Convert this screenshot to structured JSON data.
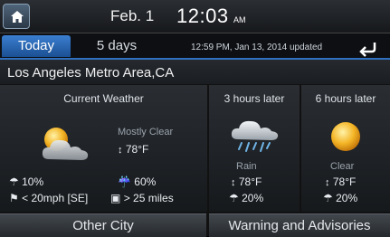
{
  "topbar": {
    "date": "Feb.  1",
    "time": "12:03",
    "ampm": "AM"
  },
  "tabs": [
    {
      "label": "Today"
    },
    {
      "label": "5 days"
    }
  ],
  "updated": "12:59 PM, Jan 13, 2014 updated",
  "location": "Los Angeles Metro Area,CA",
  "current": {
    "title": "Current Weather",
    "condition": "Mostly Clear",
    "temp": "78°F",
    "precip": "10%",
    "humidity": "60%",
    "wind": "< 20mph [SE]",
    "visibility": "> 25 miles"
  },
  "later3": {
    "title": "3 hours later",
    "condition": "Rain",
    "temp": "78°F",
    "precip": "20%"
  },
  "later6": {
    "title": "6 hours later",
    "condition": "Clear",
    "temp": "78°F",
    "precip": "20%"
  },
  "buttons": {
    "other_city": "Other City",
    "warnings": "Warning and Advisories"
  },
  "icons": [
    "home-icon",
    "back-icon",
    "partly-cloudy-icon",
    "rain-icon",
    "sun-icon",
    "umbrella-icon",
    "humidity-icon",
    "wind-icon",
    "visibility-icon",
    "temperature-icon"
  ]
}
